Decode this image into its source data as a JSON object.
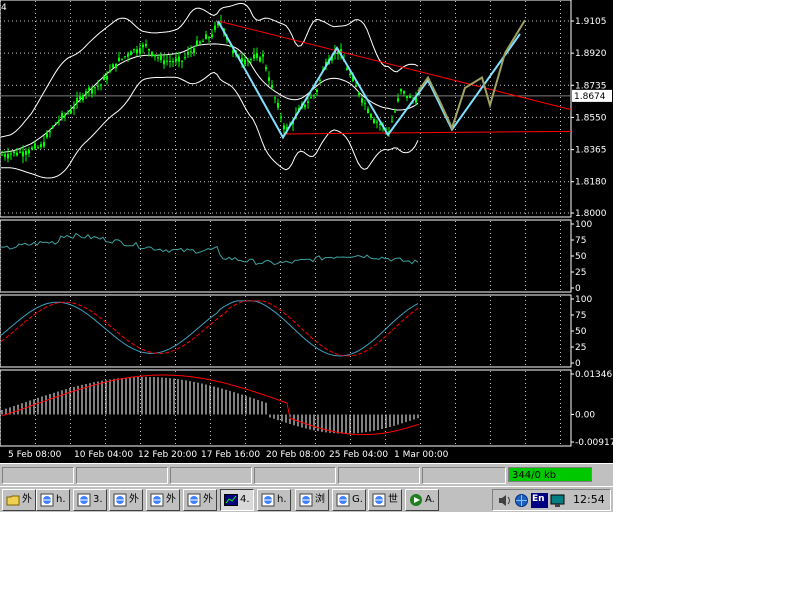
{
  "chart": {
    "corner_label": "4",
    "price_ticks": [
      "1.9105",
      "1.8920",
      "1.8735",
      "1.8550",
      "1.8365",
      "1.8180",
      "1.8000"
    ],
    "current_price": "1.8674",
    "rsi_ticks": [
      "100",
      "75",
      "50",
      "25",
      "0"
    ],
    "stoch_ticks": [
      "100",
      "75",
      "50",
      "25",
      "0"
    ],
    "macd_ticks": [
      "0.01346",
      "0.00",
      "-0.00917"
    ],
    "time_labels": [
      "5 Feb 08:00",
      "10 Feb 04:00",
      "12 Feb 20:00",
      "17 Feb 16:00",
      "20 Feb 08:00",
      "25 Feb 04:00",
      "1 Mar 00:00"
    ],
    "colors": {
      "background": "#000000",
      "grid": "#c0c0c0",
      "candle": "#00ff00",
      "bands": "#ffffff",
      "trend": "#ff0000",
      "pattern": "#80e0ff",
      "projection": "#a0a060",
      "rsi": "#40a0a0",
      "stoch_main": "#40a0c0",
      "stoch_signal": "#ff0000",
      "macd_hist": "#ffffff",
      "macd_signal": "#ff0000"
    }
  },
  "status_bar": {
    "connection": "344/0 kb"
  },
  "taskbar": {
    "buttons": [
      {
        "icon": "folder-icon",
        "label": "外"
      },
      {
        "icon": "browser-icon",
        "label": "h."
      },
      {
        "icon": "browser-icon",
        "label": "3."
      },
      {
        "icon": "browser-icon",
        "label": "外"
      },
      {
        "icon": "browser-icon",
        "label": "外"
      },
      {
        "icon": "browser-icon",
        "label": "外"
      },
      {
        "icon": "chart-app-icon",
        "label": "4."
      },
      {
        "icon": "browser-icon",
        "label": "h."
      },
      {
        "icon": "browser-icon",
        "label": "浏"
      },
      {
        "icon": "browser-icon",
        "label": "G."
      },
      {
        "icon": "browser-icon",
        "label": "世"
      },
      {
        "icon": "media-icon",
        "label": "A."
      }
    ],
    "tray": {
      "icons": [
        "speaker-icon",
        "network-icon",
        "language-icon",
        "monitor-icon"
      ],
      "language": "En",
      "clock": "12:54"
    }
  }
}
